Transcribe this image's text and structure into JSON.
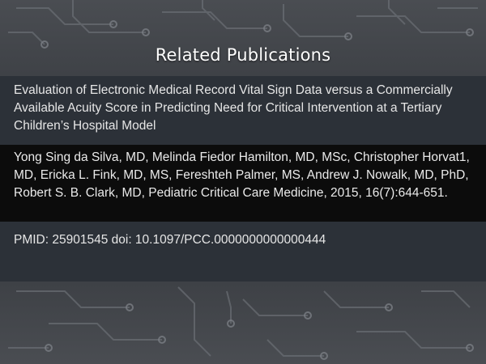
{
  "title": "Related Publications",
  "article_title": "Evaluation of Electronic Medical Record Vital Sign Data versus a Commercially Available Acuity Score in Predicting Need for Critical Intervention at a Tertiary Children’s Hospital Model",
  "citation": "Yong Sing da Silva, MD, Melinda Fiedor Hamilton, MD, MSc, Christopher Horvat1, MD, Ericka L. Fink, MD, MS, Fereshteh Palmer, MS, Andrew J. Nowalk, MD, PhD, Robert S. B. Clark, MD, Pediatric Critical Care Medicine, 2015, 16(7):644-651.",
  "pmid_line": "PMID: 25901545 doi: 10.1097/PCC.0000000000000444",
  "colors": {
    "background": "#3a3d42",
    "band_dark_blue": "#2c3138",
    "band_black": "#0c0c0c",
    "text": "#e6e6e6"
  }
}
